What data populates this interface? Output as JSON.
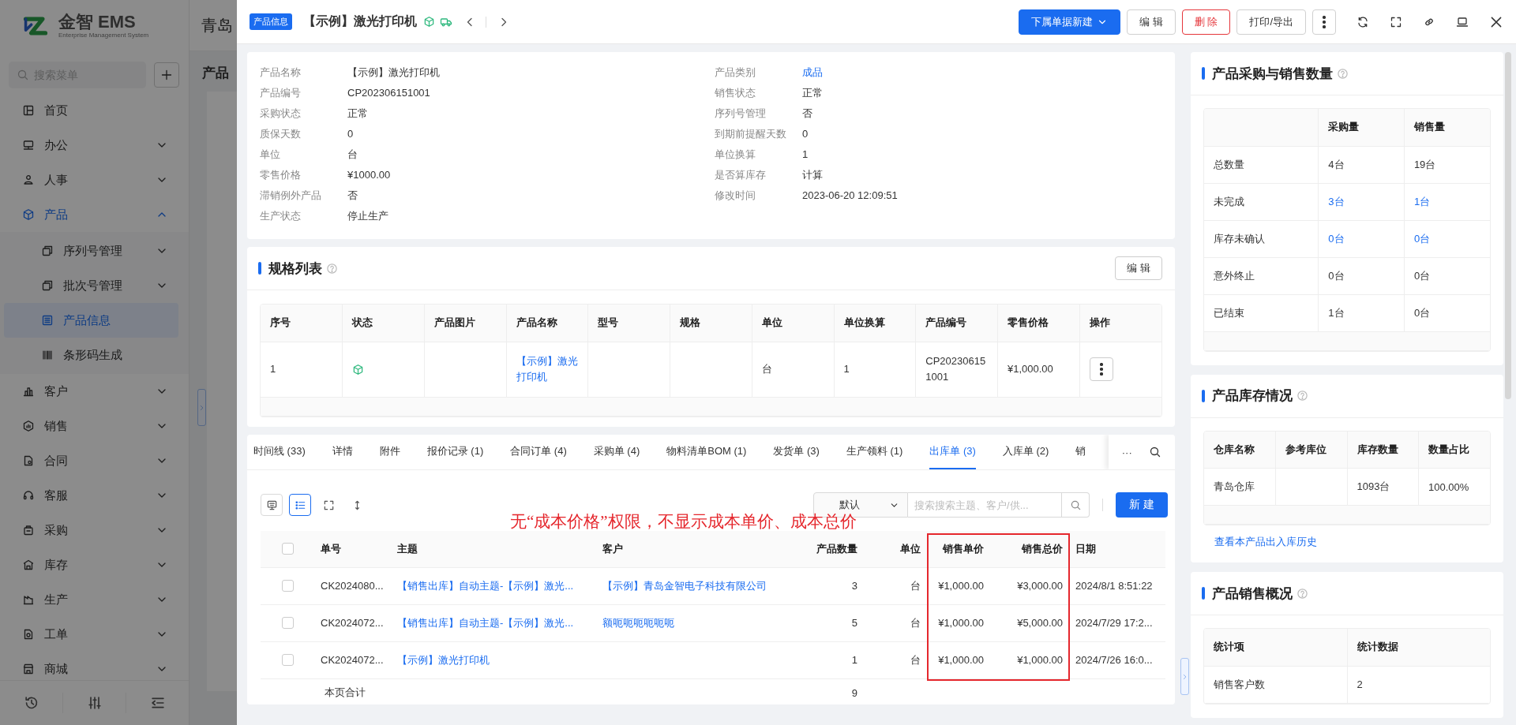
{
  "app": {
    "logo": {
      "brand": "金智 EMS",
      "tagline": "Enterprise Management System"
    },
    "company": "青岛",
    "page_title": "产品",
    "search": {
      "placeholder": "搜索菜单"
    },
    "menu": [
      {
        "label": "首页",
        "selected": false
      },
      {
        "label": "办公",
        "selected": false,
        "expanded": false
      },
      {
        "label": "人事",
        "selected": false,
        "expanded": false
      },
      {
        "label": "产品",
        "selected": false,
        "expanded": true,
        "children": [
          {
            "label": "序列号管理",
            "selected": false,
            "expanded": false
          },
          {
            "label": "批次号管理",
            "selected": false,
            "expanded": false
          },
          {
            "label": "产品信息",
            "selected": true
          },
          {
            "label": "条形码生成",
            "selected": false
          }
        ]
      },
      {
        "label": "客户",
        "selected": false,
        "expanded": false
      },
      {
        "label": "销售",
        "selected": false,
        "expanded": false
      },
      {
        "label": "合同",
        "selected": false,
        "expanded": false
      },
      {
        "label": "客服",
        "selected": false,
        "expanded": false
      },
      {
        "label": "采购",
        "selected": false,
        "expanded": false
      },
      {
        "label": "库存",
        "selected": false,
        "expanded": false
      },
      {
        "label": "生产",
        "selected": false,
        "expanded": false
      },
      {
        "label": "工单",
        "selected": false,
        "expanded": false
      },
      {
        "label": "商城",
        "selected": false,
        "expanded": false
      }
    ]
  },
  "drawer": {
    "badge": "产品信息",
    "title": "【示例】激光打印机",
    "actions": [
      {
        "label": "下属单据新建",
        "kind": "primary",
        "dropdown": true
      },
      {
        "label": "编 辑",
        "kind": "default",
        "dropdown": false
      },
      {
        "label": "删 除",
        "kind": "danger",
        "dropdown": false
      },
      {
        "label": "打印/导出",
        "kind": "default",
        "dropdown": false
      }
    ],
    "info": {
      "columns": [
        [
          {
            "label": "产品名称",
            "value": "【示例】激光打印机",
            "kind": "text"
          },
          {
            "label": "产品编号",
            "value": "CP202306151001",
            "kind": "text"
          },
          {
            "label": "采购状态",
            "value": "正常",
            "kind": "text"
          },
          {
            "label": "质保天数",
            "value": "0",
            "kind": "text"
          },
          {
            "label": "单位",
            "value": "台",
            "kind": "text"
          },
          {
            "label": "零售价格",
            "value": "¥1000.00",
            "kind": "text"
          },
          {
            "label": "滞销例外产品",
            "value": "否",
            "kind": "text"
          },
          {
            "label": "生产状态",
            "value": "停止生产",
            "kind": "text"
          }
        ],
        [
          {
            "label": "产品类别",
            "value": "成品",
            "kind": "link"
          },
          {
            "label": "销售状态",
            "value": "正常",
            "kind": "text"
          },
          {
            "label": "序列号管理",
            "value": "否",
            "kind": "text"
          },
          {
            "label": "到期前提醒天数",
            "value": "0",
            "kind": "text"
          },
          {
            "label": "单位换算",
            "value": "1",
            "kind": "text"
          },
          {
            "label": "是否算库存",
            "value": "计算",
            "kind": "text"
          },
          {
            "label": "修改时间",
            "value": "2023-06-20 12:09:51",
            "kind": "text"
          }
        ]
      ]
    },
    "specs": {
      "title": "规格列表",
      "edit": "编 辑",
      "columns": [
        "序号",
        "状态",
        "产品图片",
        "产品名称",
        "型号",
        "规格",
        "单位",
        "单位换算",
        "产品编号",
        "零售价格",
        "操作"
      ],
      "rows": [
        {
          "cells": [
            {
              "kind": "text",
              "text": "1"
            },
            {
              "kind": "status"
            },
            {
              "kind": "empty"
            },
            {
              "kind": "link",
              "text": "【示例】激光打印机"
            },
            {
              "kind": "empty"
            },
            {
              "kind": "empty"
            },
            {
              "kind": "text",
              "text": "台"
            },
            {
              "kind": "text",
              "text": "1"
            },
            {
              "kind": "text",
              "text": "CP202306151001"
            },
            {
              "kind": "text",
              "text": "¥1,000.00"
            },
            {
              "kind": "menu"
            }
          ]
        }
      ]
    },
    "orders": {
      "tabs": [
        {
          "label": "时间线 (33)",
          "selected": false
        },
        {
          "label": "详情",
          "selected": false
        },
        {
          "label": "附件",
          "selected": false
        },
        {
          "label": "报价记录 (1)",
          "selected": false
        },
        {
          "label": "合同订单 (4)",
          "selected": false
        },
        {
          "label": "采购单 (4)",
          "selected": false
        },
        {
          "label": "物料清单BOM (1)",
          "selected": false
        },
        {
          "label": "发货单 (3)",
          "selected": false
        },
        {
          "label": "生产领料 (1)",
          "selected": false
        },
        {
          "label": "出库单 (3)",
          "selected": true
        },
        {
          "label": "入库单 (2)",
          "selected": false
        },
        {
          "label": "销",
          "selected": false
        }
      ],
      "more": "···",
      "views": [
        {
          "selected": false
        },
        {
          "selected": true
        },
        {
          "selected": false
        },
        {
          "selected": false
        }
      ],
      "sort": "默认",
      "search": {
        "placeholder": "搜索搜索主题、客户/供..."
      },
      "new": "新 建",
      "note": "无“成本价格”权限，不显示成本单价、成本总价",
      "table": {
        "all_checked": false,
        "columns": [
          {
            "label": "单号",
            "highlighted": false
          },
          {
            "label": "主题",
            "highlighted": false
          },
          {
            "label": "客户",
            "highlighted": false
          },
          {
            "label": "产品数量",
            "highlighted": false
          },
          {
            "label": "单位",
            "highlighted": false
          },
          {
            "label": "销售单价",
            "highlighted": true
          },
          {
            "label": "销售总价",
            "highlighted": true
          },
          {
            "label": "日期",
            "highlighted": false
          }
        ],
        "rows": [
          {
            "checked": false,
            "cells": [
              {
                "kind": "text",
                "text": "CK2024080..."
              },
              {
                "kind": "link",
                "text": "【销售出库】自动主题-【示例】激光..."
              },
              {
                "kind": "link",
                "text": "【示例】青岛金智电子科技有限公司"
              },
              {
                "kind": "text",
                "text": "3"
              },
              {
                "kind": "text",
                "text": "台"
              },
              {
                "kind": "text",
                "text": "¥1,000.00"
              },
              {
                "kind": "text",
                "text": "¥3,000.00"
              },
              {
                "kind": "text",
                "text": "2024/8/1 8:51:22"
              }
            ]
          },
          {
            "checked": false,
            "cells": [
              {
                "kind": "text",
                "text": "CK2024072..."
              },
              {
                "kind": "link",
                "text": "【销售出库】自动主题-【示例】激光..."
              },
              {
                "kind": "link",
                "text": "额呃呃呃呃呃呃"
              },
              {
                "kind": "text",
                "text": "5"
              },
              {
                "kind": "text",
                "text": "台"
              },
              {
                "kind": "text",
                "text": "¥1,000.00"
              },
              {
                "kind": "text",
                "text": "¥5,000.00"
              },
              {
                "kind": "text",
                "text": "2024/7/29 17:2..."
              }
            ]
          },
          {
            "checked": false,
            "cells": [
              {
                "kind": "text",
                "text": "CK2024072..."
              },
              {
                "kind": "link",
                "text": "【示例】激光打印机"
              },
              {
                "kind": "empty"
              },
              {
                "kind": "text",
                "text": "1"
              },
              {
                "kind": "text",
                "text": "台"
              },
              {
                "kind": "text",
                "text": "¥1,000.00"
              },
              {
                "kind": "text",
                "text": "¥1,000.00"
              },
              {
                "kind": "text",
                "text": "2024/7/26 16:0..."
              }
            ]
          }
        ],
        "total": {
          "label": "本页合计",
          "quantity": "9"
        }
      }
    },
    "panels": [
      {
        "kind": "matrix",
        "title": "产品采购与销售数量",
        "columns": [
          "采购量",
          "销售量"
        ],
        "rows": [
          {
            "label": "总数量",
            "cells": [
              {
                "text": "4台",
                "link": false
              },
              {
                "text": "19台",
                "link": false
              }
            ]
          },
          {
            "label": "未完成",
            "cells": [
              {
                "text": "3台",
                "link": true
              },
              {
                "text": "1台",
                "link": true
              }
            ]
          },
          {
            "label": "库存未确认",
            "cells": [
              {
                "text": "0台",
                "link": true
              },
              {
                "text": "0台",
                "link": true
              }
            ]
          },
          {
            "label": "意外终止",
            "cells": [
              {
                "text": "0台",
                "link": false
              },
              {
                "text": "0台",
                "link": false
              }
            ]
          },
          {
            "label": "已结束",
            "cells": [
              {
                "text": "1台",
                "link": false
              },
              {
                "text": "0台",
                "link": false
              }
            ]
          }
        ]
      },
      {
        "kind": "table",
        "title": "产品库存情况",
        "columns": [
          "仓库名称",
          "参考库位",
          "库存数量",
          "数量占比"
        ],
        "rows": [
          [
            "青岛仓库",
            null,
            "1093台",
            "100.00%"
          ]
        ],
        "footer_link": "查看本产品出入库历史"
      },
      {
        "kind": "table",
        "title": "产品销售概况",
        "columns": [
          "统计项",
          "统计数据"
        ],
        "rows": [
          [
            "销售客户数",
            "2"
          ]
        ]
      }
    ]
  }
}
